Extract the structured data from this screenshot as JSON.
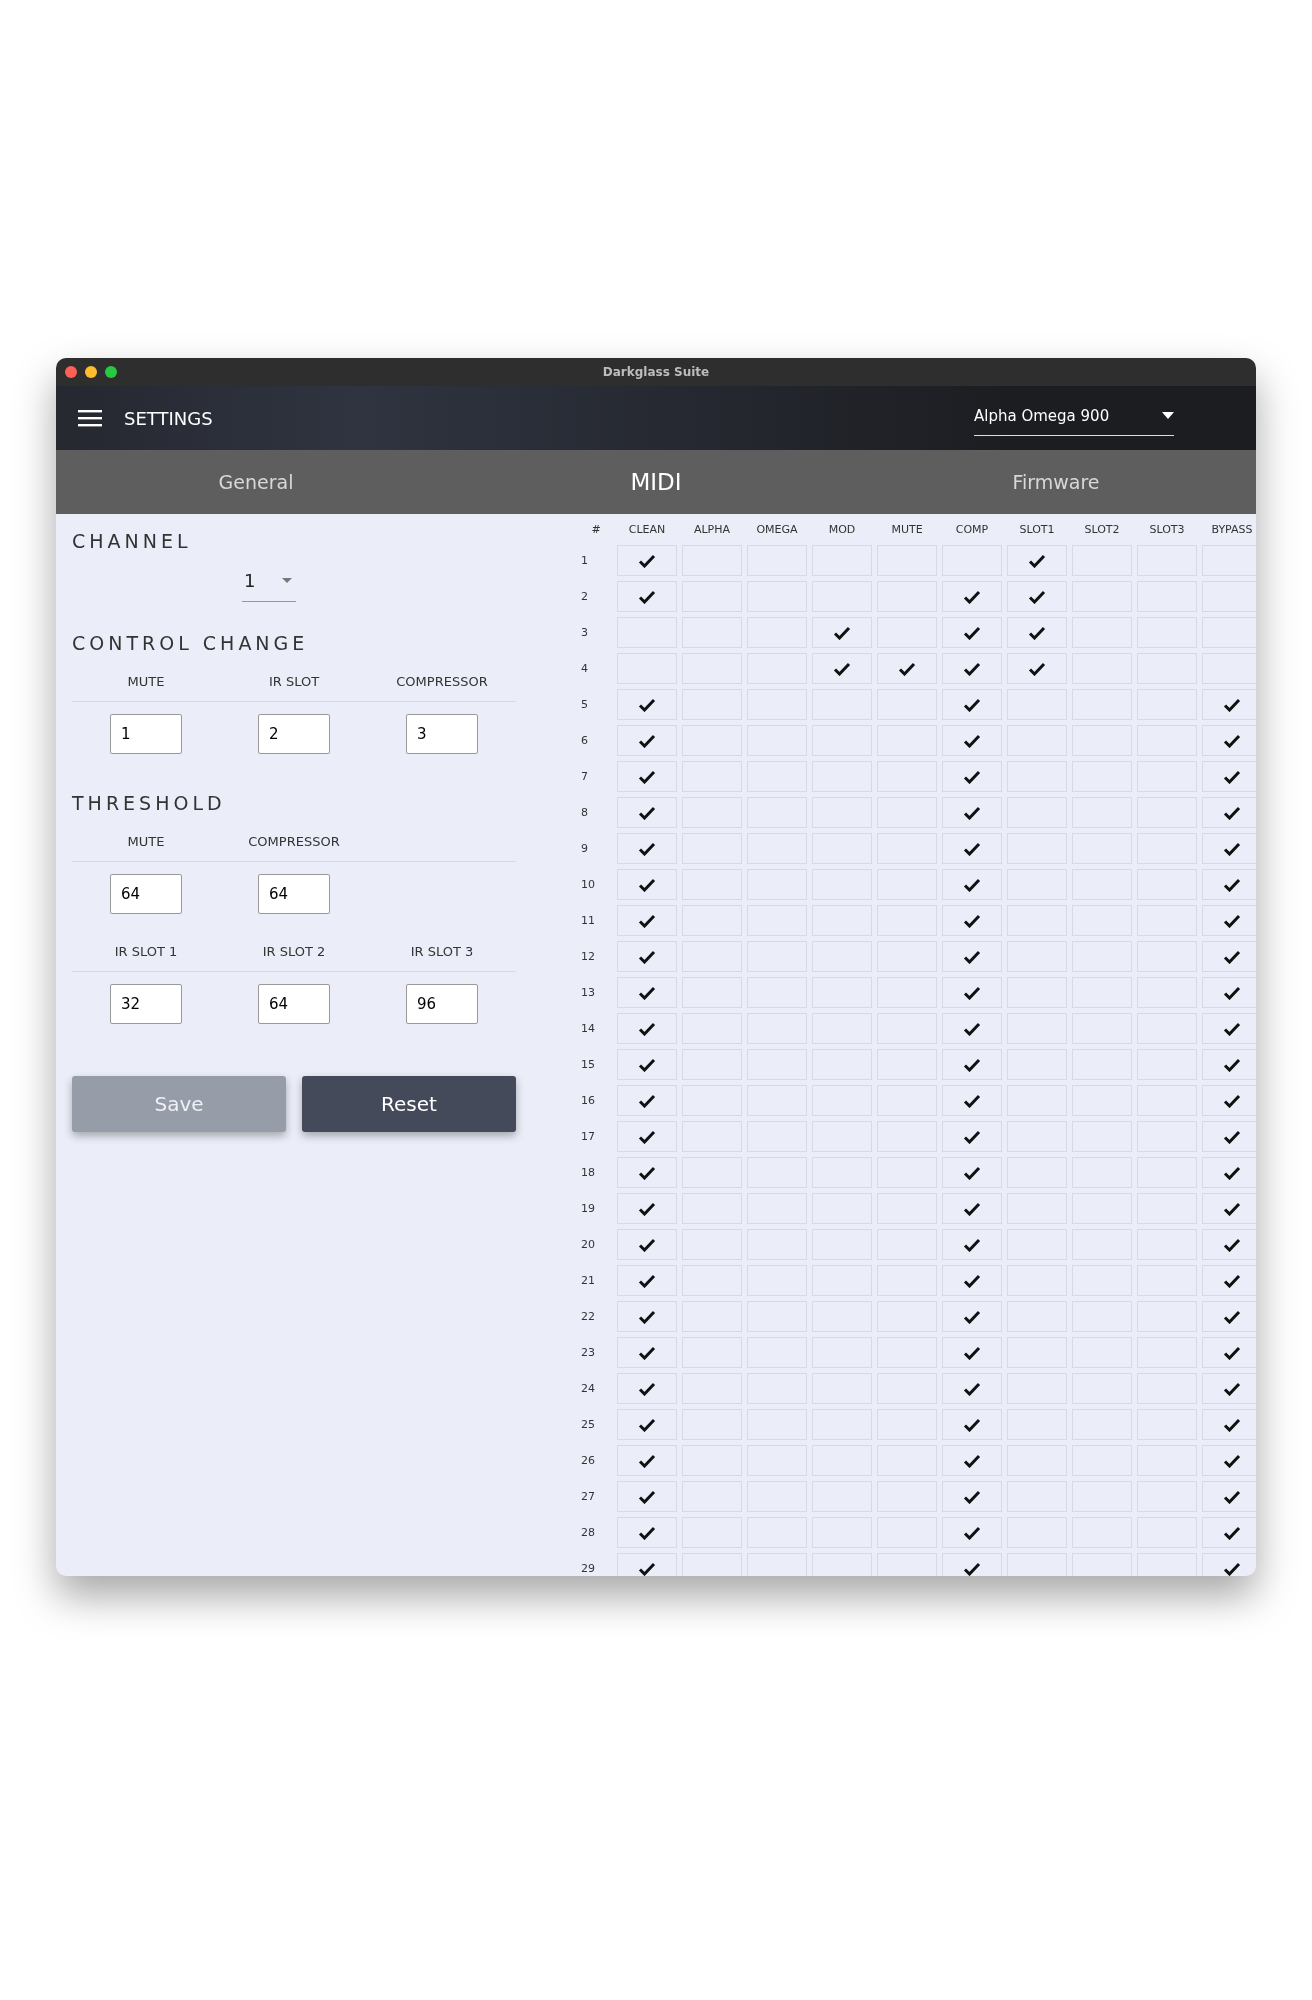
{
  "window": {
    "title": "Darkglass Suite"
  },
  "header": {
    "title": "SETTINGS",
    "device": "Alpha Omega 900"
  },
  "tabs": [
    {
      "label": "General",
      "selected": false
    },
    {
      "label": "MIDI",
      "selected": true
    },
    {
      "label": "Firmware",
      "selected": false
    }
  ],
  "channel": {
    "heading": "CHANNEL",
    "value": "1"
  },
  "control_change": {
    "heading": "CONTROL CHANGE",
    "fields": [
      {
        "label": "MUTE",
        "value": "1"
      },
      {
        "label": "IR SLOT",
        "value": "2"
      },
      {
        "label": "COMPRESSOR",
        "value": "3"
      }
    ]
  },
  "threshold": {
    "heading": "THRESHOLD",
    "groups": [
      [
        {
          "label": "MUTE",
          "value": "64"
        },
        {
          "label": "COMPRESSOR",
          "value": "64"
        }
      ],
      [
        {
          "label": "IR SLOT 1",
          "value": "32"
        },
        {
          "label": "IR SLOT 2",
          "value": "64"
        },
        {
          "label": "IR SLOT 3",
          "value": "96"
        }
      ]
    ]
  },
  "buttons": [
    {
      "label": "Save",
      "disabled": true
    },
    {
      "label": "Reset",
      "disabled": false
    }
  ],
  "table": {
    "columns": [
      "#",
      "CLEAN",
      "ALPHA",
      "OMEGA",
      "MOD",
      "MUTE",
      "COMP",
      "SLOT1",
      "SLOT2",
      "SLOT3",
      "BYPASS"
    ],
    "rows": [
      {
        "number": "1",
        "checks": [
          true,
          false,
          false,
          false,
          false,
          false,
          true,
          false,
          false,
          false
        ]
      },
      {
        "number": "2",
        "checks": [
          true,
          false,
          false,
          false,
          false,
          true,
          true,
          false,
          false,
          false
        ]
      },
      {
        "number": "3",
        "checks": [
          false,
          false,
          false,
          true,
          false,
          true,
          true,
          false,
          false,
          false
        ]
      },
      {
        "number": "4",
        "checks": [
          false,
          false,
          false,
          true,
          true,
          true,
          true,
          false,
          false,
          false
        ]
      },
      {
        "number": "5",
        "checks": [
          true,
          false,
          false,
          false,
          false,
          true,
          false,
          false,
          false,
          true
        ]
      },
      {
        "number": "6",
        "checks": [
          true,
          false,
          false,
          false,
          false,
          true,
          false,
          false,
          false,
          true
        ]
      },
      {
        "number": "7",
        "checks": [
          true,
          false,
          false,
          false,
          false,
          true,
          false,
          false,
          false,
          true
        ]
      },
      {
        "number": "8",
        "checks": [
          true,
          false,
          false,
          false,
          false,
          true,
          false,
          false,
          false,
          true
        ]
      },
      {
        "number": "9",
        "checks": [
          true,
          false,
          false,
          false,
          false,
          true,
          false,
          false,
          false,
          true
        ]
      },
      {
        "number": "10",
        "checks": [
          true,
          false,
          false,
          false,
          false,
          true,
          false,
          false,
          false,
          true
        ]
      },
      {
        "number": "11",
        "checks": [
          true,
          false,
          false,
          false,
          false,
          true,
          false,
          false,
          false,
          true
        ]
      },
      {
        "number": "12",
        "checks": [
          true,
          false,
          false,
          false,
          false,
          true,
          false,
          false,
          false,
          true
        ]
      },
      {
        "number": "13",
        "checks": [
          true,
          false,
          false,
          false,
          false,
          true,
          false,
          false,
          false,
          true
        ]
      },
      {
        "number": "14",
        "checks": [
          true,
          false,
          false,
          false,
          false,
          true,
          false,
          false,
          false,
          true
        ]
      },
      {
        "number": "15",
        "checks": [
          true,
          false,
          false,
          false,
          false,
          true,
          false,
          false,
          false,
          true
        ]
      },
      {
        "number": "16",
        "checks": [
          true,
          false,
          false,
          false,
          false,
          true,
          false,
          false,
          false,
          true
        ]
      },
      {
        "number": "17",
        "checks": [
          true,
          false,
          false,
          false,
          false,
          true,
          false,
          false,
          false,
          true
        ]
      },
      {
        "number": "18",
        "checks": [
          true,
          false,
          false,
          false,
          false,
          true,
          false,
          false,
          false,
          true
        ]
      },
      {
        "number": "19",
        "checks": [
          true,
          false,
          false,
          false,
          false,
          true,
          false,
          false,
          false,
          true
        ]
      },
      {
        "number": "20",
        "checks": [
          true,
          false,
          false,
          false,
          false,
          true,
          false,
          false,
          false,
          true
        ]
      },
      {
        "number": "21",
        "checks": [
          true,
          false,
          false,
          false,
          false,
          true,
          false,
          false,
          false,
          true
        ]
      },
      {
        "number": "22",
        "checks": [
          true,
          false,
          false,
          false,
          false,
          true,
          false,
          false,
          false,
          true
        ]
      },
      {
        "number": "23",
        "checks": [
          true,
          false,
          false,
          false,
          false,
          true,
          false,
          false,
          false,
          true
        ]
      },
      {
        "number": "24",
        "checks": [
          true,
          false,
          false,
          false,
          false,
          true,
          false,
          false,
          false,
          true
        ]
      },
      {
        "number": "25",
        "checks": [
          true,
          false,
          false,
          false,
          false,
          true,
          false,
          false,
          false,
          true
        ]
      },
      {
        "number": "26",
        "checks": [
          true,
          false,
          false,
          false,
          false,
          true,
          false,
          false,
          false,
          true
        ]
      },
      {
        "number": "27",
        "checks": [
          true,
          false,
          false,
          false,
          false,
          true,
          false,
          false,
          false,
          true
        ]
      },
      {
        "number": "28",
        "checks": [
          true,
          false,
          false,
          false,
          false,
          true,
          false,
          false,
          false,
          true
        ]
      },
      {
        "number": "29",
        "checks": [
          true,
          false,
          false,
          false,
          false,
          true,
          false,
          false,
          false,
          true
        ]
      }
    ]
  }
}
